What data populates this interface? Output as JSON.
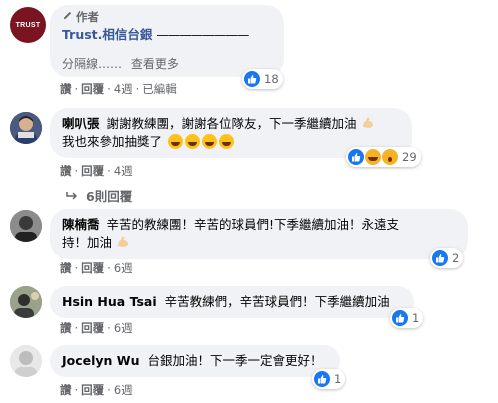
{
  "comments": [
    {
      "author_tag": "作者",
      "author": "Trust.相信台銀",
      "text_line1": "————————",
      "text_line2": "分隔線……",
      "see_more": "查看更多",
      "actions": {
        "like": "讚",
        "reply": "回覆",
        "time": "4週",
        "edited": "已編輯"
      },
      "reactions": {
        "count": "18"
      }
    },
    {
      "author": "喇叭張",
      "text_line1": "謝謝教練團，謝謝各位隊友，下一季繼續加油",
      "text_line2": "我也來參加抽獎了",
      "actions": {
        "like": "讚",
        "reply": "回覆",
        "time": "4週"
      },
      "reactions": {
        "count": "29"
      },
      "replies_label": "6則回覆"
    },
    {
      "author": "陳楠喬",
      "text_line1": "辛苦的教練團！辛苦的球員們!下季繼續加油！永遠支",
      "text_line2": "持！加油",
      "actions": {
        "like": "讚",
        "reply": "回覆",
        "time": "6週"
      },
      "reactions": {
        "count": "2"
      }
    },
    {
      "author": "Hsin Hua Tsai",
      "text_line1": "辛苦教練們，辛苦球員們！下季繼續加油",
      "actions": {
        "like": "讚",
        "reply": "回覆",
        "time": "6週"
      },
      "reactions": {
        "count": "1"
      }
    },
    {
      "author": "Jocelyn Wu",
      "text_line1": "台銀加油！下一季一定會更好！",
      "actions": {
        "like": "讚",
        "reply": "回覆",
        "time": "6週"
      },
      "reactions": {
        "count": "1"
      }
    }
  ],
  "avatar_logo_text": "TRUST",
  "colors": {
    "like": "#1877f2",
    "link": "#385898",
    "bubble": "#f0f2f5",
    "meta": "#65676b"
  }
}
